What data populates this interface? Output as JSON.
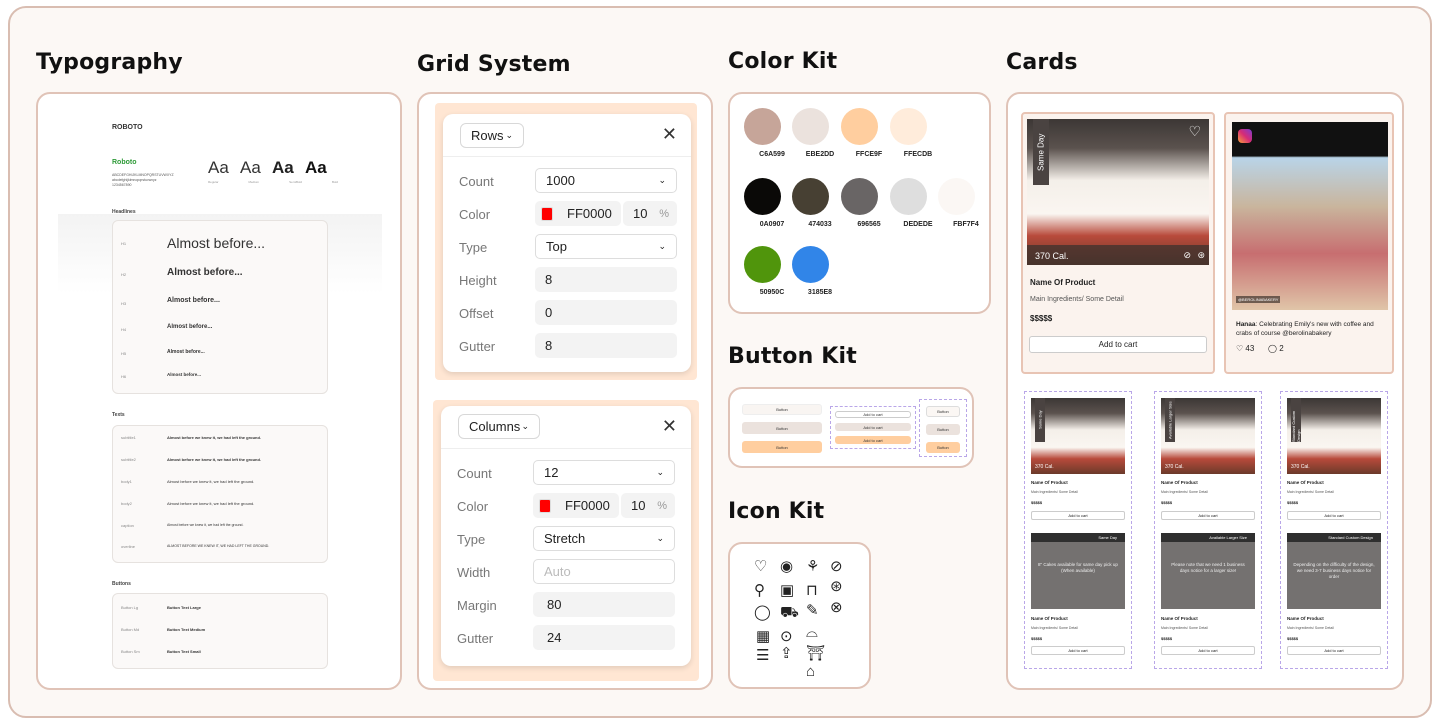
{
  "headings": {
    "typography": "Typography",
    "grid": "Grid System",
    "color": "Color Kit",
    "button": "Button Kit",
    "icon": "Icon Kit",
    "cards": "Cards"
  },
  "typography": {
    "font_title": "ROBOTO",
    "font_name": "Roboto",
    "alphabet_1": "ABCDEFGHIJKLMNOPQRSTUVWXYZ",
    "alphabet_2": "abcdefghijklmnopqrstuvwxyz",
    "digits": "1234567890",
    "samples": [
      "Aa",
      "Aa",
      "Aa",
      "Aa"
    ],
    "weights": [
      "Regular",
      "Medium",
      "SemiBold",
      "Bold"
    ],
    "headlines_label": "Headlines",
    "headlines": [
      {
        "tag": "H1",
        "text": "Almost before..."
      },
      {
        "tag": "H2",
        "text": "Almost before..."
      },
      {
        "tag": "H3",
        "text": "Almost before..."
      },
      {
        "tag": "H4",
        "text": "Almost before..."
      },
      {
        "tag": "H5",
        "text": "Almost before..."
      },
      {
        "tag": "H6",
        "text": "Almost before..."
      }
    ],
    "texts_label": "Texts",
    "texts": [
      {
        "tag": "subtitle1",
        "text": "Almost before we knew it, we had left the ground."
      },
      {
        "tag": "subtitle2",
        "text": "Almost before we knew it, we had left the ground."
      },
      {
        "tag": "body1",
        "text": "Almost before we knew it, we had left the ground."
      },
      {
        "tag": "body2",
        "text": "Almost before we knew it, we had left the ground."
      },
      {
        "tag": "caption",
        "text": "Almost before we knew it, we had left the ground."
      },
      {
        "tag": "overline",
        "text": "ALMOST BEFORE WE KNEW IT, WE HAD LEFT THE GROUND."
      }
    ],
    "buttons_label": "Buttons",
    "buttons": [
      {
        "tag": "Button Lg",
        "text": "Button Text Large"
      },
      {
        "tag": "Button Md",
        "text": "Button Text Medium"
      },
      {
        "tag": "Button Sm",
        "text": "Button Text Small"
      }
    ]
  },
  "grid_rows": {
    "select": "Rows",
    "fields": [
      {
        "label": "Count",
        "value": "1000",
        "kind": "select"
      },
      {
        "label": "Color",
        "value": "FF0000",
        "opacity": "10",
        "unit": "%",
        "kind": "color"
      },
      {
        "label": "Type",
        "value": "Top",
        "kind": "select"
      },
      {
        "label": "Height",
        "value": "8",
        "kind": "text"
      },
      {
        "label": "Offset",
        "value": "0",
        "kind": "text"
      },
      {
        "label": "Gutter",
        "value": "8",
        "kind": "text"
      }
    ]
  },
  "grid_columns": {
    "select": "Columns",
    "fields": [
      {
        "label": "Count",
        "value": "12",
        "kind": "select"
      },
      {
        "label": "Color",
        "value": "FF0000",
        "opacity": "10",
        "unit": "%",
        "kind": "color"
      },
      {
        "label": "Type",
        "value": "Stretch",
        "kind": "select"
      },
      {
        "label": "Width",
        "value": "",
        "placeholder": "Auto",
        "kind": "input"
      },
      {
        "label": "Margin",
        "value": "80",
        "kind": "text"
      },
      {
        "label": "Gutter",
        "value": "24",
        "kind": "text"
      }
    ]
  },
  "colors": [
    {
      "hex": "#C6A599",
      "label": "C6A599"
    },
    {
      "hex": "#EBE2DD",
      "label": "EBE2DD"
    },
    {
      "hex": "#FFCE9F",
      "label": "FFCE9F"
    },
    {
      "hex": "#FFECDB",
      "label": "FFECDB"
    },
    {
      "hex": "#0A0907",
      "label": "0A0907"
    },
    {
      "hex": "#474033",
      "label": "474033"
    },
    {
      "hex": "#696565",
      "label": "696565"
    },
    {
      "hex": "#DEDEDE",
      "label": "DEDEDE"
    },
    {
      "hex": "#FBF7F4",
      "label": "FBF7F4"
    },
    {
      "hex": "#50950C",
      "label": "50950C"
    },
    {
      "hex": "#3185E8",
      "label": "3185E8"
    }
  ],
  "button_kit": {
    "button": "Button",
    "add_to_cart": "Add to cart"
  },
  "icons": [
    "heart-icon",
    "user-icon",
    "plant-icon",
    "leaf-badge-icon",
    "search-icon",
    "instagram-icon",
    "bag-icon",
    "leaf-circle-icon",
    "chat-icon",
    "cart-icon",
    "pencil-icon",
    "close-circle-icon",
    "calendar-icon",
    "location-icon",
    "cupcake-icon",
    "sliders-icon",
    "share-icon",
    "cake-icon",
    "cake-box-icon"
  ],
  "cards": {
    "product": {
      "badge": "Same Day",
      "calories": "370 Cal.",
      "name": "Name Of Product",
      "ingredients": "Main Ingredients/ Some Detail",
      "price": "$$$$$",
      "cta": "Add to cart"
    },
    "social": {
      "handle": "@BEROLINABAKERY",
      "user": "Hanaa",
      "caption": "Celebrating Emily's new with coffee and crabs of course @berolinabakery",
      "likes": "43",
      "comments": "2"
    },
    "variants": [
      {
        "badge": "Same Day",
        "title": "Same Day",
        "desc": "8\" Cakes available for same day pick up (When available)"
      },
      {
        "badge": "Available Larger Size",
        "title": "Available Larger Size",
        "desc": "Please note that we need 1 business days notice for a larger size!"
      },
      {
        "badge": "Standard Custom Design",
        "title": "Standard Custom Design",
        "desc": "Depending on the difficulty of the design, we need 3-7 business days notice for order"
      }
    ]
  }
}
